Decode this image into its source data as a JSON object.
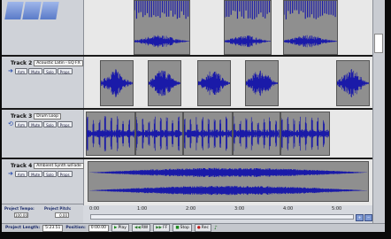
{
  "tracks": [
    {
      "label": "Track 2",
      "desc": "Acoustic Latin - EQ FX"
    },
    {
      "label": "Track 3",
      "desc": "Drum Loop"
    },
    {
      "label": "Track 4",
      "desc": "Ambient Synth w/Fade"
    }
  ],
  "buttons": {
    "arm": "Arm",
    "mute": "Mute",
    "solo": "Solo",
    "props": "Props"
  },
  "project": {
    "tempo_label": "Project Tempo:",
    "tempo_value": "100.00",
    "pitch_label": "Project Pitch:",
    "pitch_value": "0.00"
  },
  "ruler": [
    "0:00",
    "1:00",
    "2:00",
    "3:00",
    "4:00",
    "5:00"
  ],
  "transport": {
    "length_label": "Project Length:",
    "length_value": "5:23.51",
    "position_label": "Position:",
    "position_value": "0:00.00",
    "play": "Play",
    "rew": "RW",
    "ff": "FF",
    "stop": "Stop",
    "rec": "Rec"
  },
  "colors": {
    "wave": "#1a1aa8",
    "clip": "#8f8f8f",
    "lane": "#e8e8e8",
    "header": "#cfd2d8"
  }
}
